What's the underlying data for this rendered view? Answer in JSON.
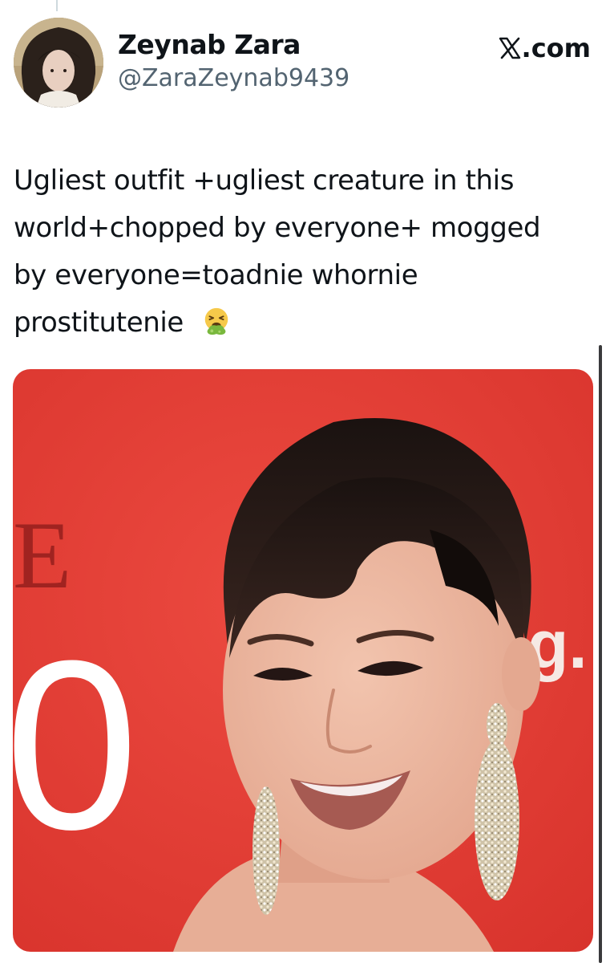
{
  "tweet": {
    "author": {
      "display_name": "Zeynab Zara",
      "handle": "@ZaraZeynab9439",
      "avatar_icon": "avatar-photo"
    },
    "brand": {
      "logo_icon": "x-logo-icon",
      "text": ".com"
    },
    "text_lines": [
      "Ugliest outfit +ugliest creature in this",
      "world+chopped by everyone+ mogged",
      "by everyone=toadnie whornie",
      "prostitutenie"
    ],
    "emoji_icon": "vomiting-face-emoji",
    "media": {
      "type": "photo",
      "background_color": "#e33a32",
      "backdrop_letters": [
        "E",
        "0",
        "g."
      ]
    }
  },
  "colors": {
    "text_primary": "#0f1419",
    "text_secondary": "#536471",
    "thread_line": "#cfd9de",
    "scrollbar": "#3a3a3c"
  }
}
